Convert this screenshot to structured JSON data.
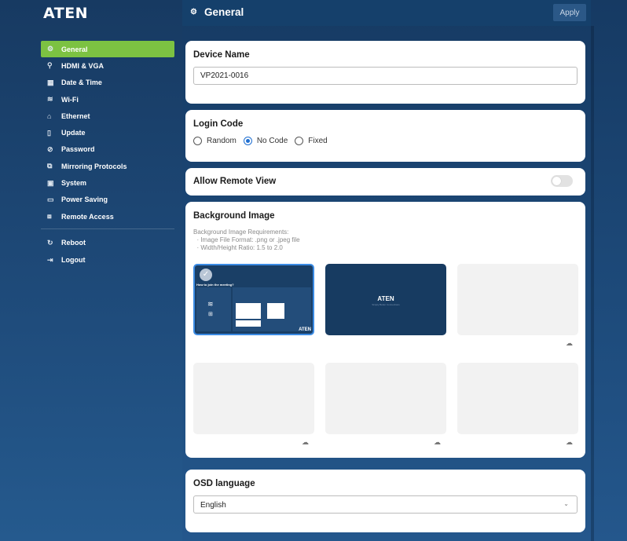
{
  "brand": {
    "logo": "ATEN"
  },
  "sidebar": {
    "items": [
      {
        "icon": "settings-icon",
        "glyph": "⚙",
        "label": "General",
        "active": true
      },
      {
        "icon": "hdmi-vga-icon",
        "glyph": "⚲",
        "label": "HDMI & VGA"
      },
      {
        "icon": "calendar-icon",
        "glyph": "▦",
        "label": "Date & Time"
      },
      {
        "icon": "wifi-icon",
        "glyph": "≋",
        "label": "Wi-Fi"
      },
      {
        "icon": "ethernet-icon",
        "glyph": "⌂",
        "label": "Ethernet"
      },
      {
        "icon": "update-icon",
        "glyph": "▯",
        "label": "Update"
      },
      {
        "icon": "password-icon",
        "glyph": "⊘",
        "label": "Password"
      },
      {
        "icon": "mirroring-icon",
        "glyph": "⧉",
        "label": "Mirroring Protocols"
      },
      {
        "icon": "system-icon",
        "glyph": "▣",
        "label": "System"
      },
      {
        "icon": "power-saving-icon",
        "glyph": "▭",
        "label": "Power Saving"
      },
      {
        "icon": "remote-access-icon",
        "glyph": "⧈",
        "label": "Remote Access"
      }
    ],
    "actions": [
      {
        "icon": "reboot-icon",
        "glyph": "↻",
        "label": "Reboot"
      },
      {
        "icon": "logout-icon",
        "glyph": "⇥",
        "label": "Logout"
      }
    ]
  },
  "header": {
    "title": "General",
    "icon": "settings-icon",
    "apply_label": "Apply"
  },
  "device_name": {
    "title": "Device Name",
    "value": "VP2021-0016"
  },
  "login_code": {
    "title": "Login Code",
    "options": [
      "Random",
      "No Code",
      "Fixed"
    ],
    "selected": "No Code"
  },
  "remote_view": {
    "title": "Allow Remote View",
    "enabled": false
  },
  "background": {
    "title": "Background Image",
    "requirements": [
      "Background Image Requirements:",
      "  · Image File Format: .png or .jpeg file",
      "  · Width/Height Ratio: 1.5 to 2.0"
    ],
    "thumb1": {
      "title": "How to join the meeting?",
      "aten": "ATEN"
    },
    "thumb2": {
      "logo": "ATEN",
      "sub": "Simply Better Connections"
    }
  },
  "osd": {
    "title": "OSD language",
    "value": "English"
  },
  "colors": {
    "accent": "#7cc242",
    "header": "#15406b",
    "radio": "#1f6fd1"
  }
}
